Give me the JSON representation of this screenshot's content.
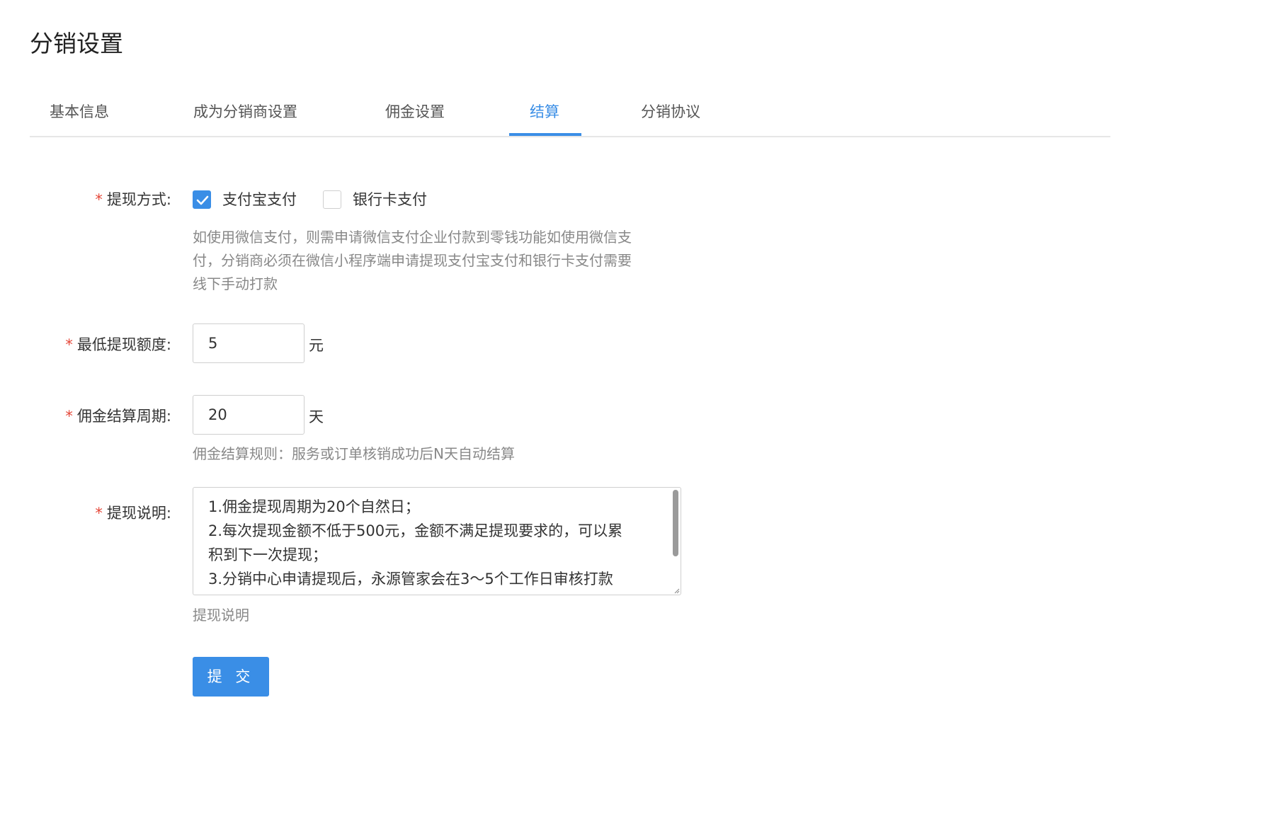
{
  "page": {
    "title": "分销设置"
  },
  "tabs": [
    {
      "label": "基本信息"
    },
    {
      "label": "成为分销商设置"
    },
    {
      "label": "佣金设置"
    },
    {
      "label": "结算",
      "active": true
    },
    {
      "label": "分销协议"
    }
  ],
  "form": {
    "required_mark": "*",
    "withdraw_method": {
      "label": "提现方式:",
      "options": [
        {
          "label": "支付宝支付",
          "checked": true
        },
        {
          "label": "银行卡支付",
          "checked": false
        }
      ],
      "hint_lines": [
        "如使用微信支付，则需申请微信支付企业付款到零钱功能如使用微信支",
        "付，分销商必须在微信小程序端申请提现支付宝支付和银行卡支付需要",
        "线下手动打款"
      ]
    },
    "min_withdraw": {
      "label": "最低提现额度:",
      "value": "5",
      "unit": "元"
    },
    "settle_cycle": {
      "label": "佣金结算周期:",
      "value": "20",
      "unit": "天",
      "hint": "佣金结算规则：服务或订单核销成功后N天自动结算"
    },
    "withdraw_note": {
      "label": "提现说明:",
      "lines": [
        "1.佣金提现周期为20个自然日；",
        "2.每次提现金额不低于500元，金额不满足提现要求的，可以累",
        "积到下一次提现；",
        "3.分销中心申请提现后，永源管家会在3～5个工作日审核打款"
      ],
      "hint": "提现说明"
    },
    "submit_label": "提 交"
  },
  "colors": {
    "accent": "#3a8ee6",
    "required": "#e5483a",
    "hint": "#888888"
  }
}
